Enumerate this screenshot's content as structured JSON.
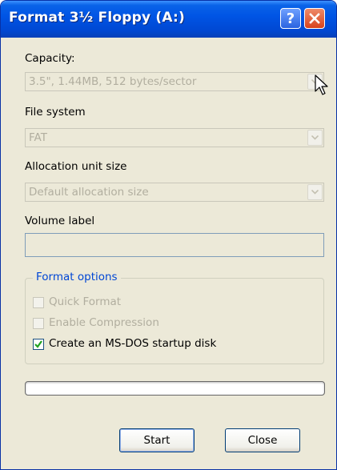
{
  "window": {
    "title": "Format 3½ Floppy (A:)",
    "help_icon": "question-mark-icon",
    "close_icon": "close-x-icon"
  },
  "capacity": {
    "label": "Capacity:",
    "value": "3.5\",  1.44MB, 512 bytes/sector"
  },
  "file_system": {
    "label": "File system",
    "value": "FAT"
  },
  "allocation": {
    "label": "Allocation unit size",
    "value": "Default allocation size"
  },
  "volume": {
    "label": "Volume label",
    "value": ""
  },
  "format_options": {
    "label": "Format options",
    "quick_format": {
      "label": "Quick Format",
      "checked": false,
      "enabled": false
    },
    "compression": {
      "label": "Enable Compression",
      "checked": false,
      "enabled": false
    },
    "msdos_startup": {
      "label": "Create an MS-DOS startup disk",
      "checked": true,
      "enabled": true
    }
  },
  "progress": 0,
  "buttons": {
    "start": "Start",
    "close": "Close"
  },
  "colors": {
    "titlebar": "#0055e5",
    "dialog_bg": "#ece9d8",
    "group_label": "#0046d5",
    "disabled_text": "#b1ae9f",
    "checkmark": "#21a121"
  }
}
